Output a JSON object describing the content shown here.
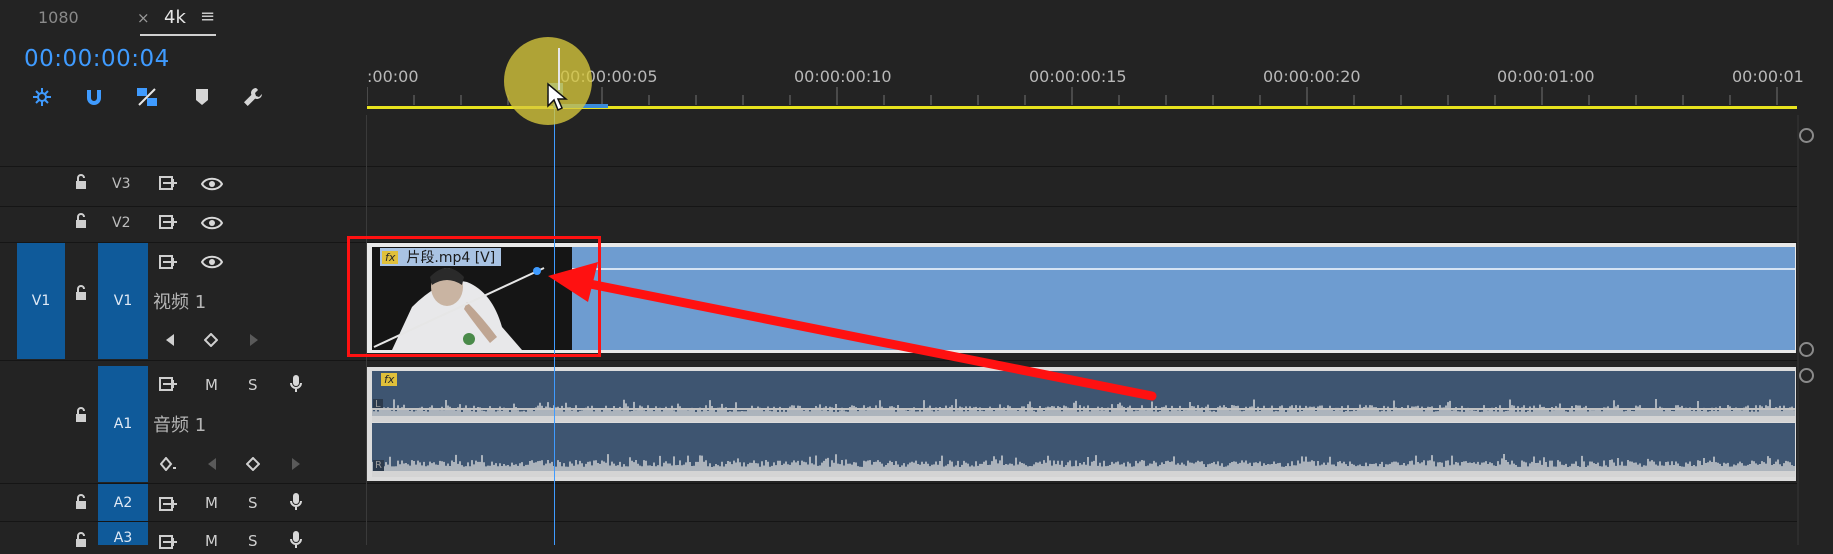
{
  "tabs": [
    {
      "label": "1080"
    },
    {
      "label": "4k",
      "close": "×",
      "menu": "≡"
    }
  ],
  "timecode": "00:00:00:04",
  "toolbar": [
    {
      "icon": "insert-overwrite-icon"
    },
    {
      "icon": "snap-magnet-icon"
    },
    {
      "icon": "linked-selection-icon"
    },
    {
      "icon": "add-marker-icon"
    },
    {
      "icon": "wrench-settings-icon"
    }
  ],
  "ruler": {
    "labels": [
      ":00:00",
      "00:00:00:05",
      "00:00:00:10",
      "00:00:00:15",
      "00:00:00:20",
      "00:00:01:00",
      "00:00:01"
    ]
  },
  "tracks": {
    "v3": {
      "name": "V3"
    },
    "v2": {
      "name": "V2"
    },
    "v1": {
      "source": "V1",
      "name": "V1",
      "title": "视频 1"
    },
    "a1": {
      "name": "A1",
      "title": "音频 1",
      "m": "M",
      "s": "S"
    },
    "a2": {
      "name": "A2",
      "m": "M",
      "s": "S"
    },
    "a3": {
      "name": "A3",
      "m": "M",
      "s": "S"
    }
  },
  "clips": {
    "video_name": "片段.mp4 [V]",
    "fx": "fx",
    "audio_fx": "fx",
    "audio_ch1": "L",
    "audio_ch2": "R"
  },
  "colors": {
    "accent": "#3f9bff",
    "track_selected": "#0f5a9a",
    "video_clip": "#6e9cd0",
    "audio_clip": "#3e5571",
    "annotation": "#ff1111",
    "work_area": "#e8e31e"
  }
}
